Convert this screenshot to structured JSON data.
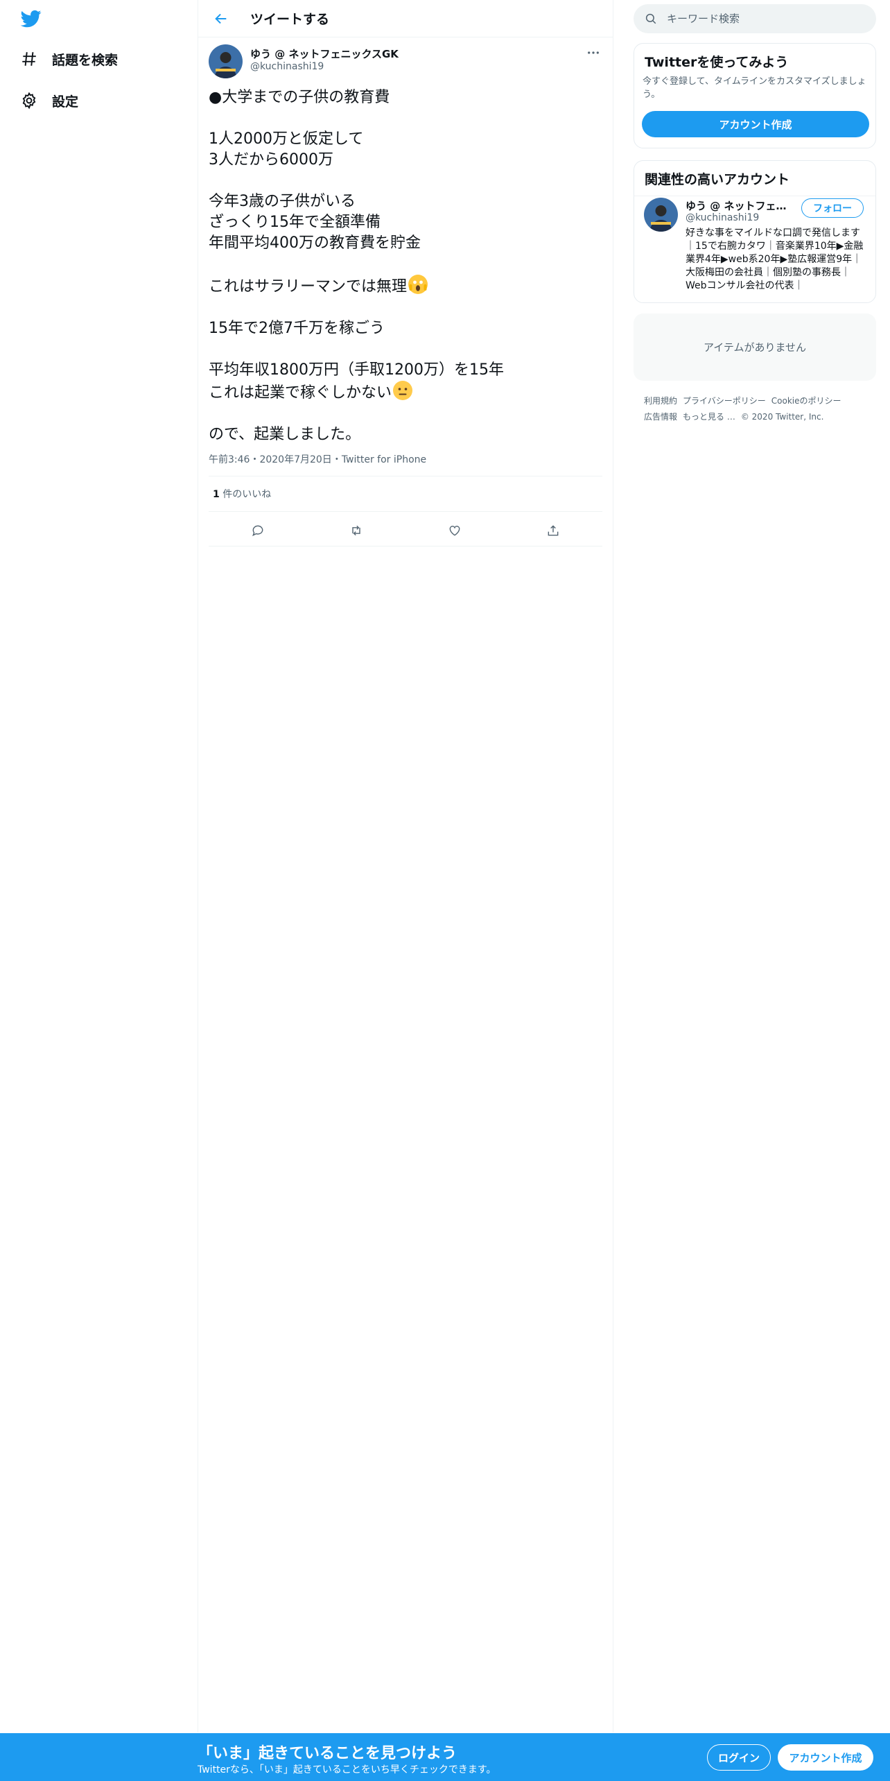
{
  "colors": {
    "accent": "#1d9bf0",
    "text": "#0f1419",
    "muted": "#536471",
    "border": "#eff3f4",
    "banner": "#1d9bf0"
  },
  "sidebar": {
    "logo_icon": "twitter-bird-icon",
    "items": [
      {
        "label": "話題を検索",
        "icon": "hashtag-icon"
      },
      {
        "label": "設定",
        "icon": "gear-icon"
      }
    ]
  },
  "header": {
    "title": "ツイートする",
    "back_icon": "back-arrow-icon"
  },
  "tweet": {
    "author_name": "ゆう @ ネットフェニックスGK",
    "author_handle": "@kuchinashi19",
    "lines": [
      "●大学までの子供の教育費",
      "",
      "1人2000万と仮定して",
      "3人だから6000万",
      "",
      "今年3歳の子供がいる",
      "ざっくり15年で全額準備",
      "年間平均400万の教育費を貯金",
      "",
      "これはサラリーマンでは無理",
      "",
      "15年で2億7千万を稼ごう",
      "",
      "平均年収1800万円（手取1200万）を15年",
      "これは起業で稼ぐしかない",
      "",
      "ので、起業しました。"
    ],
    "emojis": [
      "😱",
      "😐"
    ],
    "time": "午前3:46",
    "date": "2020年7月20日",
    "source": "Twitter for iPhone",
    "meta_separator": "・",
    "likes_count": "1",
    "likes_label": "件のいいね",
    "action_icons": [
      "reply-icon",
      "retweet-icon",
      "like-icon",
      "share-icon"
    ]
  },
  "right": {
    "search_placeholder": "キーワード検索",
    "signup_card": {
      "title": "Twitterを使ってみよう",
      "description": "今すぐ登録して、タイムラインをカスタマイズしましょう。",
      "button": "アカウント作成"
    },
    "relevant": {
      "title": "関連性の高いアカウント",
      "name": "ゆう @ ネットフェニックスGK",
      "handle": "@kuchinashi19",
      "follow": "フォロー",
      "bio": "好きな事をマイルドな口調で発信します｜15で右腕カタワ｜音楽業界10年▶金融業界4年▶web系20年▶塾広報運営9年｜大阪梅田の会社員｜個別塾の事務長｜Webコンサル会社の代表｜"
    },
    "empty_message": "アイテムがありません",
    "footer": {
      "links": [
        "利用規約",
        "プライバシーポリシー",
        "Cookieのポリシー",
        "広告情報",
        "もっと見る …"
      ],
      "copyright": "© 2020 Twitter, Inc."
    }
  },
  "banner": {
    "title": "「いま」起きていることを見つけよう",
    "subtitle": "Twitterなら、「いま」起きていることをいち早くチェックできます。",
    "login": "ログイン",
    "signup": "アカウント作成"
  }
}
